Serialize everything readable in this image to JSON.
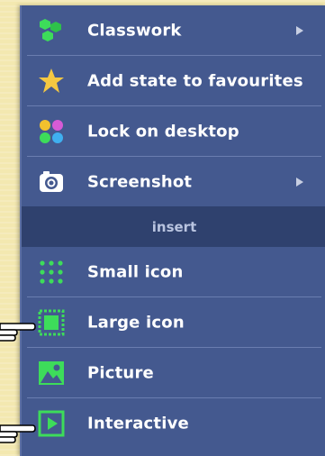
{
  "menu": {
    "items": [
      {
        "label": "Classwork",
        "icon": "hexagon-cluster-icon",
        "submenu": true
      },
      {
        "label": "Add state to favourites",
        "icon": "star-icon",
        "submenu": false
      },
      {
        "label": "Lock on desktop",
        "icon": "colored-dots-icon",
        "submenu": false
      },
      {
        "label": "Screenshot",
        "icon": "camera-icon",
        "submenu": true
      }
    ],
    "section_label": "insert",
    "insert_items": [
      {
        "label": "Small icon",
        "icon": "small-dots-grid-icon"
      },
      {
        "label": "Large icon",
        "icon": "large-square-icon"
      },
      {
        "label": "Picture",
        "icon": "picture-icon"
      },
      {
        "label": "Interactive",
        "icon": "play-square-icon"
      }
    ]
  },
  "colors": {
    "menu_bg": "#44598f",
    "section_bg": "#2f416e",
    "accent_green": "#3ddc5a",
    "star_yellow": "#f5c842"
  }
}
